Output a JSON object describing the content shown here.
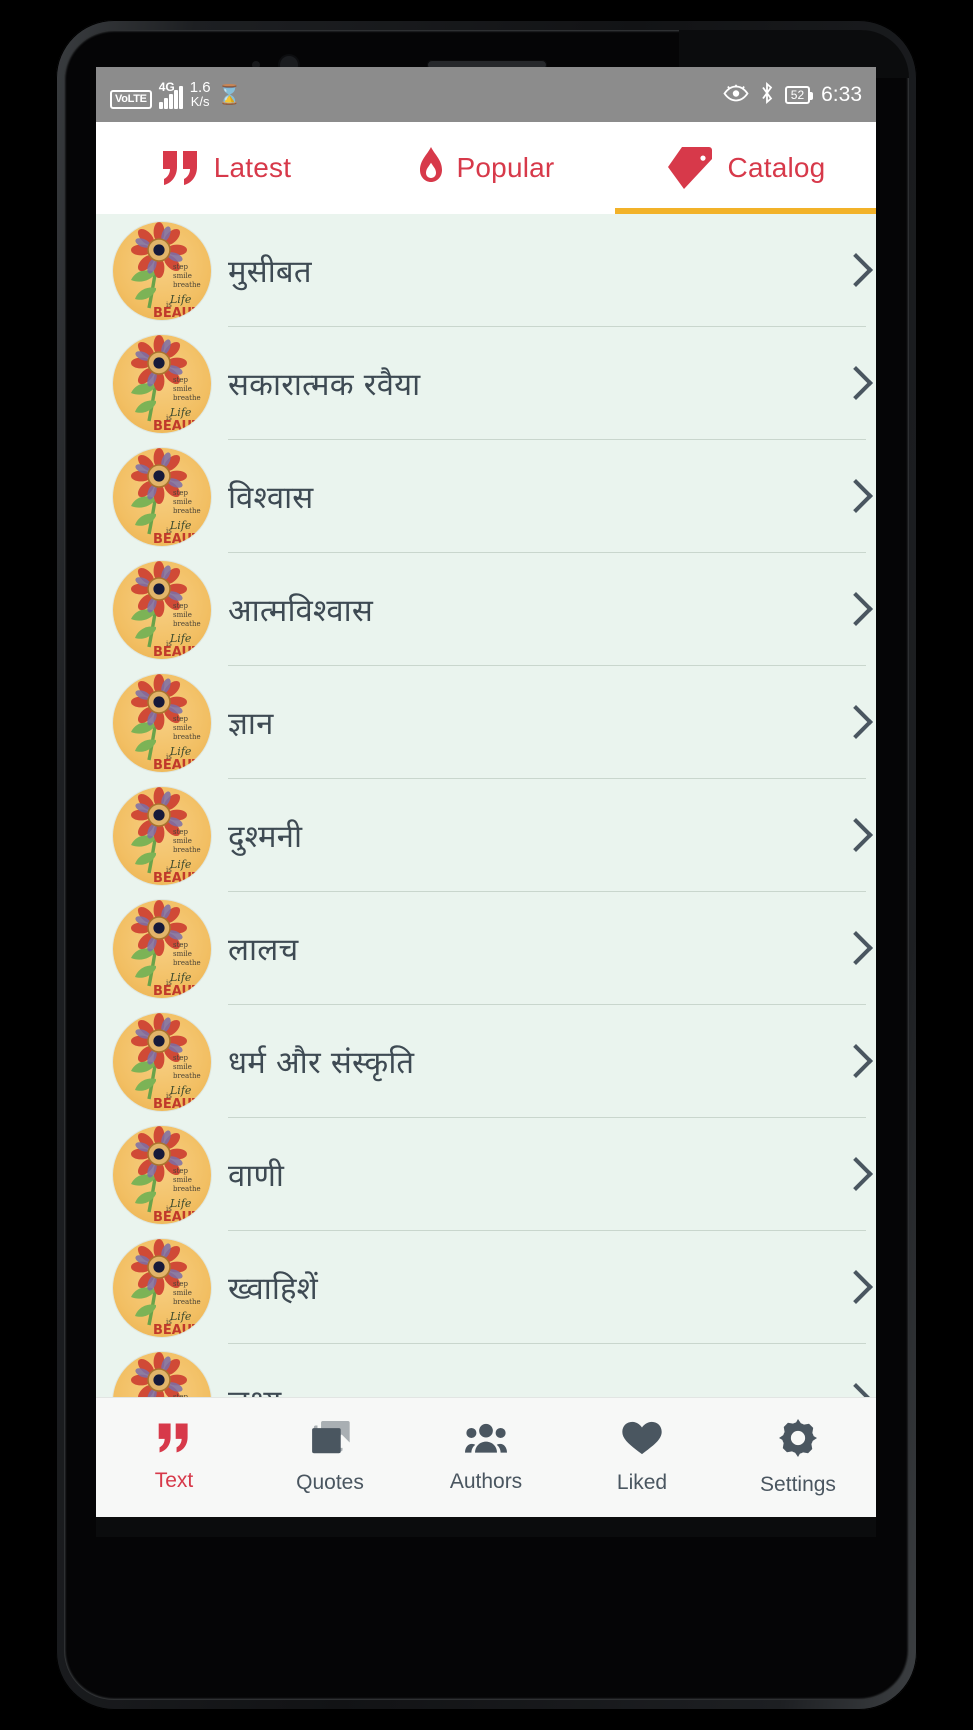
{
  "status_bar": {
    "volte": "VoLTE",
    "network": "4G",
    "speed_value": "1.6",
    "speed_unit": "K/s",
    "hourglass_icon": "hourglass-icon",
    "eye_comfort_icon": "eye-icon",
    "bluetooth_icon": "bluetooth-icon",
    "battery_percent": "52",
    "clock": "6:33"
  },
  "tabs": [
    {
      "label": "Latest",
      "icon": "quote-icon",
      "selected": false
    },
    {
      "label": "Popular",
      "icon": "flame-icon",
      "selected": false
    },
    {
      "label": "Catalog",
      "icon": "tag-icon",
      "selected": true
    }
  ],
  "colors": {
    "accent_red": "#d7394a",
    "indicator_yellow": "#f2b229",
    "list_background": "#eaf4ee",
    "text_dark": "#3e4a53",
    "avatar_orange": "#f2bf63",
    "status_bar_gray": "#8c8c8c"
  },
  "catalog": {
    "items": [
      {
        "title": "मुसीबत",
        "avatar": "flower-avatar",
        "chevron": "chevron-right-icon"
      },
      {
        "title": "सकारात्मक रवैया",
        "avatar": "flower-avatar",
        "chevron": "chevron-right-icon"
      },
      {
        "title": "विश्वास",
        "avatar": "flower-avatar",
        "chevron": "chevron-right-icon"
      },
      {
        "title": "आत्मविश्वास",
        "avatar": "flower-avatar",
        "chevron": "chevron-right-icon"
      },
      {
        "title": "ज्ञान",
        "avatar": "flower-avatar",
        "chevron": "chevron-right-icon"
      },
      {
        "title": "दुश्मनी",
        "avatar": "flower-avatar",
        "chevron": "chevron-right-icon"
      },
      {
        "title": "लालच",
        "avatar": "flower-avatar",
        "chevron": "chevron-right-icon"
      },
      {
        "title": "धर्म और संस्कृति",
        "avatar": "flower-avatar",
        "chevron": "chevron-right-icon"
      },
      {
        "title": "वाणी",
        "avatar": "flower-avatar",
        "chevron": "chevron-right-icon"
      },
      {
        "title": "ख्वाहिशें",
        "avatar": "flower-avatar",
        "chevron": "chevron-right-icon"
      },
      {
        "title": "लक्ष्य",
        "avatar": "flower-avatar",
        "chevron": "chevron-right-icon"
      }
    ]
  },
  "avatar_art": {
    "line1": "step",
    "line2": "smile",
    "line3": "breathe",
    "word_life": "Life",
    "word_is": "is",
    "word_beautiful": "BEAUTIFUL"
  },
  "bottom_nav": [
    {
      "label": "Text",
      "icon": "quote-icon",
      "active": true
    },
    {
      "label": "Quotes",
      "icon": "images-icon",
      "active": false
    },
    {
      "label": "Authors",
      "icon": "people-icon",
      "active": false
    },
    {
      "label": "Liked",
      "icon": "heart-icon",
      "active": false
    },
    {
      "label": "Settings",
      "icon": "gear-icon",
      "active": false
    }
  ]
}
